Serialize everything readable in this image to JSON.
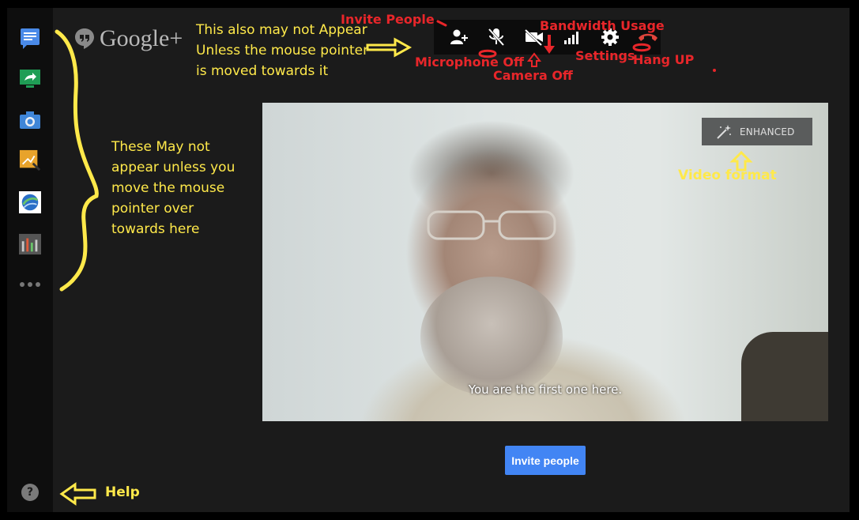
{
  "brand": {
    "name": "Google+"
  },
  "sidebar": {
    "apps": [
      {
        "icon": "chat-icon"
      },
      {
        "icon": "screenshare-icon"
      },
      {
        "icon": "camera-icon"
      },
      {
        "icon": "effects-icon"
      },
      {
        "icon": "google-earth-icon"
      },
      {
        "icon": "equalizer-icon"
      },
      {
        "icon": "more-icon"
      }
    ],
    "help_label": "?"
  },
  "toolbar": {
    "buttons": [
      {
        "icon": "invite-people-icon"
      },
      {
        "icon": "microphone-off-icon"
      },
      {
        "icon": "camera-off-icon"
      },
      {
        "icon": "bandwidth-icon"
      },
      {
        "icon": "settings-icon"
      },
      {
        "icon": "hang-up-icon"
      }
    ]
  },
  "video": {
    "enhanced_label": "ENHANCED",
    "status_text": "You are the first one here."
  },
  "invite_button": {
    "label": "Invite people"
  },
  "annotations": {
    "toolbar_note": [
      "This also may not Appear",
      "Unless the mouse pointer",
      "is moved towards it"
    ],
    "sidebar_note": [
      "These May not",
      "appear unless you",
      "move the mouse",
      "pointer over",
      "towards here"
    ],
    "invite_people": "Invite People",
    "bandwidth_usage": "Bandwidth Usage",
    "microphone_off": "Microphone Off",
    "settings": "Settings",
    "hang_up": "Hang UP",
    "camera_off": "Camera Off",
    "video_format": "Video format",
    "help": "Help"
  },
  "colors": {
    "annotation_yellow": "#ffe94a",
    "annotation_red": "#e8262a",
    "invite_blue": "#4285f4",
    "hangup_red": "#e0443b"
  }
}
